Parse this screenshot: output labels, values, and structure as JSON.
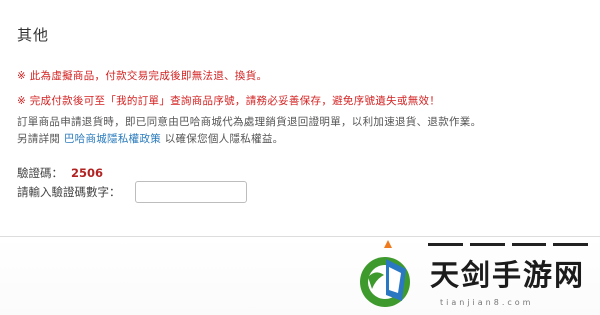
{
  "section": {
    "title": "其他"
  },
  "notices": [
    "※ 此為虛擬商品，付款交易完成後即無法退、換貨。",
    "※ 完成付款後可至「我的訂單」查詢商品序號，請務必妥善保存，避免序號遺失或無效！"
  ],
  "info": {
    "line1": "訂單商品申請退貨時，即已同意由巴哈商城代為處理銷貨退回證明單，以利加速退貨、退款作業。",
    "line2_prefix": "另請詳閱",
    "line2_link": "巴哈商城隱私權政策",
    "line2_suffix": "以確保您個人隱私權益。"
  },
  "captcha": {
    "label": "驗證碼：",
    "code": "2506",
    "input_label": "請輸入驗證碼數字：",
    "input_value": ""
  },
  "watermark": {
    "brand": "天剑手游网",
    "sub": "tianjian8.com"
  },
  "colors": {
    "notice_red": "#d32222",
    "link_blue": "#2a7bbd",
    "code_red": "#b22222",
    "accent_orange": "#f07a1e",
    "logo_green": "#3f9a2e",
    "logo_blue": "#2b78c2"
  }
}
